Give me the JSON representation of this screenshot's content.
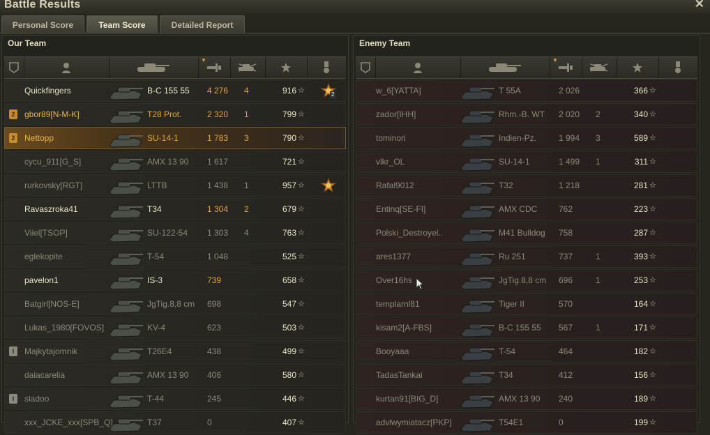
{
  "window": {
    "title": "Battle Results",
    "close_icon": "×"
  },
  "tabs": [
    {
      "label": "Personal Score",
      "active": false
    },
    {
      "label": "Team Score",
      "active": true
    },
    {
      "label": "Detailed Report",
      "active": false
    }
  ],
  "our_team": {
    "title": "Our Team",
    "rows": [
      {
        "badge": "",
        "name": "Quickfingers",
        "vehicle": "B-C 155 55",
        "damage": "4 276",
        "kills": "4",
        "xp": "916",
        "medal": true,
        "medal_count": "2",
        "style": "bright"
      },
      {
        "badge": "2",
        "name": "gbor89[N-M-K]",
        "vehicle": "T28 Prot.",
        "damage": "2 320",
        "kills": "1",
        "xp": "799",
        "medal": false,
        "medal_count": "",
        "style": "gold"
      },
      {
        "badge": "2",
        "name": "Nettopp",
        "vehicle": "SU-14-1",
        "damage": "1 783",
        "kills": "3",
        "xp": "790",
        "medal": false,
        "medal_count": "",
        "style": "me"
      },
      {
        "badge": "",
        "name": "cycu_911[G_S]",
        "vehicle": "AMX 13 90",
        "damage": "1 617",
        "kills": "",
        "xp": "721",
        "medal": false,
        "medal_count": "",
        "style": "dim"
      },
      {
        "badge": "",
        "name": "rurkovsky[RGT]",
        "vehicle": "LTTB",
        "damage": "1 438",
        "kills": "1",
        "xp": "957",
        "medal": true,
        "medal_count": "",
        "style": "dim"
      },
      {
        "badge": "",
        "name": "Ravaszroka41",
        "vehicle": "T34",
        "damage": "1 304",
        "kills": "2",
        "xp": "679",
        "medal": false,
        "medal_count": "",
        "style": "bright"
      },
      {
        "badge": "",
        "name": "Viiel[TSOP]",
        "vehicle": "SU-122-54",
        "damage": "1 303",
        "kills": "4",
        "xp": "763",
        "medal": false,
        "medal_count": "",
        "style": "dim"
      },
      {
        "badge": "",
        "name": "eglekopite",
        "vehicle": "T-54",
        "damage": "1 048",
        "kills": "",
        "xp": "525",
        "medal": false,
        "medal_count": "",
        "style": "dim"
      },
      {
        "badge": "",
        "name": "pavelon1",
        "vehicle": "IS-3",
        "damage": "739",
        "kills": "",
        "xp": "658",
        "medal": false,
        "medal_count": "",
        "style": "bright"
      },
      {
        "badge": "",
        "name": "Batgirl[NOS-E]",
        "vehicle": "JgTig.8,8 cm",
        "damage": "698",
        "kills": "",
        "xp": "547",
        "medal": false,
        "medal_count": "",
        "style": "dim"
      },
      {
        "badge": "",
        "name": "Lukas_1980[FOVOS]",
        "vehicle": "KV-4",
        "damage": "623",
        "kills": "",
        "xp": "503",
        "medal": false,
        "medal_count": "",
        "style": "dim"
      },
      {
        "badge": "I",
        "name": "Majkytajomnik",
        "vehicle": "T26E4",
        "damage": "438",
        "kills": "",
        "xp": "499",
        "medal": false,
        "medal_count": "",
        "style": "dim"
      },
      {
        "badge": "",
        "name": "dalacarelia",
        "vehicle": "AMX 13 90",
        "damage": "406",
        "kills": "",
        "xp": "580",
        "medal": false,
        "medal_count": "",
        "style": "dim"
      },
      {
        "badge": "I",
        "name": "sladoo",
        "vehicle": "T-44",
        "damage": "245",
        "kills": "",
        "xp": "446",
        "medal": false,
        "medal_count": "",
        "style": "dim"
      },
      {
        "badge": "",
        "name": "xxx_JCKE_xxx[SPB_Q]",
        "vehicle": "T37",
        "damage": "0",
        "kills": "",
        "xp": "407",
        "medal": false,
        "medal_count": "",
        "style": "dim"
      }
    ]
  },
  "enemy_team": {
    "title": "Enemy Team",
    "rows": [
      {
        "badge": "",
        "name": "w_6[YATTA]",
        "vehicle": "T 55A",
        "damage": "2 026",
        "kills": "",
        "xp": "366",
        "medal": false,
        "medal_count": "",
        "style": "dim"
      },
      {
        "badge": "",
        "name": "zador[IHH]",
        "vehicle": "Rhm.-B. WT",
        "damage": "2 020",
        "kills": "2",
        "xp": "340",
        "medal": false,
        "medal_count": "",
        "style": "dim"
      },
      {
        "badge": "",
        "name": "tominori",
        "vehicle": "Indien-Pz.",
        "damage": "1 994",
        "kills": "3",
        "xp": "589",
        "medal": false,
        "medal_count": "",
        "style": "dim"
      },
      {
        "badge": "",
        "name": "vlkr_OL",
        "vehicle": "SU-14-1",
        "damage": "1 499",
        "kills": "1",
        "xp": "311",
        "medal": false,
        "medal_count": "",
        "style": "dim"
      },
      {
        "badge": "",
        "name": "Rafal9012",
        "vehicle": "T32",
        "damage": "1 218",
        "kills": "",
        "xp": "281",
        "medal": false,
        "medal_count": "",
        "style": "dim"
      },
      {
        "badge": "",
        "name": "Entinq[SE-FI]",
        "vehicle": "AMX CDC",
        "damage": "762",
        "kills": "",
        "xp": "223",
        "medal": false,
        "medal_count": "",
        "style": "dim"
      },
      {
        "badge": "",
        "name": "Polski_Destroyel..",
        "vehicle": "M41 Bulldog",
        "damage": "758",
        "kills": "",
        "xp": "287",
        "medal": false,
        "medal_count": "",
        "style": "dim"
      },
      {
        "badge": "",
        "name": "ares1377",
        "vehicle": "Ru 251",
        "damage": "737",
        "kills": "1",
        "xp": "393",
        "medal": false,
        "medal_count": "",
        "style": "dim"
      },
      {
        "badge": "",
        "name": "Over16hs",
        "vehicle": "JgTig.8,8 cm",
        "damage": "696",
        "kills": "1",
        "xp": "253",
        "medal": false,
        "medal_count": "",
        "style": "dim"
      },
      {
        "badge": "",
        "name": "templarnl81",
        "vehicle": "Tiger II",
        "damage": "570",
        "kills": "",
        "xp": "164",
        "medal": false,
        "medal_count": "",
        "style": "dim"
      },
      {
        "badge": "",
        "name": "kisam2[A-FBS]",
        "vehicle": "B-C 155 55",
        "damage": "567",
        "kills": "1",
        "xp": "171",
        "medal": false,
        "medal_count": "",
        "style": "dim"
      },
      {
        "badge": "",
        "name": "Booyaaa",
        "vehicle": "T-54",
        "damage": "464",
        "kills": "",
        "xp": "182",
        "medal": false,
        "medal_count": "",
        "style": "dim"
      },
      {
        "badge": "",
        "name": "TadasTankai",
        "vehicle": "T34",
        "damage": "412",
        "kills": "",
        "xp": "156",
        "medal": false,
        "medal_count": "",
        "style": "dim"
      },
      {
        "badge": "",
        "name": "kurtan91[BIG_D]",
        "vehicle": "AMX 13 90",
        "damage": "240",
        "kills": "",
        "xp": "189",
        "medal": false,
        "medal_count": "",
        "style": "dim"
      },
      {
        "badge": "",
        "name": "advlwymiatacz[PKP]",
        "vehicle": "T54E1",
        "damage": "0",
        "kills": "",
        "xp": "199",
        "medal": false,
        "medal_count": "",
        "style": "dim"
      }
    ]
  },
  "icons": {
    "header_columns": [
      "squad-icon",
      "player-icon",
      "vehicle-icon",
      "damage-icon",
      "kills-icon",
      "xp-star-icon",
      "medal-icon"
    ],
    "xp_star": "☆"
  },
  "colors": {
    "gold_name": "#e9b44c",
    "player_row": "#6a4a1f",
    "enemy_row": "#2d2321"
  }
}
